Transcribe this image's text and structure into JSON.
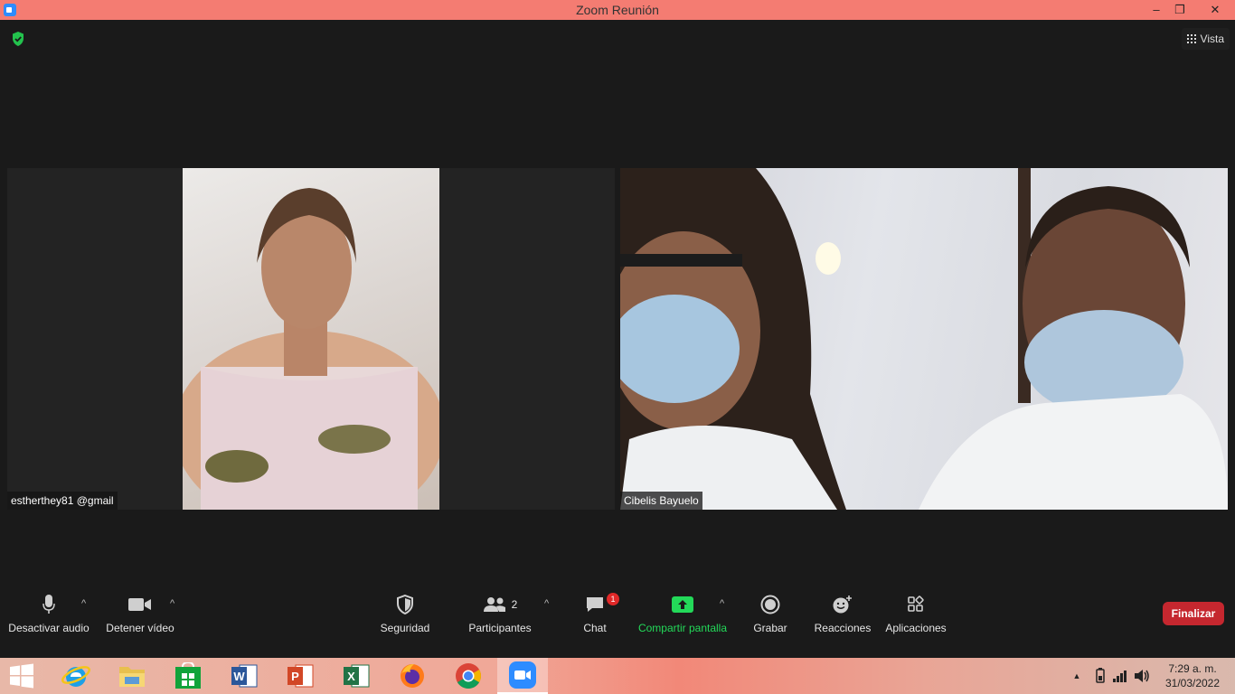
{
  "window": {
    "title": "Zoom Reunión",
    "minimize": "–",
    "maximize": "❐",
    "close": "✕"
  },
  "header": {
    "view_label": "Vista"
  },
  "participants": [
    {
      "name": "estherthey81 @gmail"
    },
    {
      "name": "Cibelis Bayuelo"
    }
  ],
  "toolbar": {
    "mute_label": "Desactivar audio",
    "video_label": "Detener vídeo",
    "security_label": "Seguridad",
    "participants_label": "Participantes",
    "participants_count": "2",
    "chat_label": "Chat",
    "chat_badge": "1",
    "share_label": "Compartir pantalla",
    "record_label": "Grabar",
    "reactions_label": "Reacciones",
    "apps_label": "Aplicaciones",
    "end_label": "Finalizar",
    "caret": "^"
  },
  "taskbar": {
    "apps": [
      "start-icon",
      "internet-explorer-icon",
      "file-explorer-icon",
      "store-icon",
      "word-icon",
      "powerpoint-icon",
      "excel-icon",
      "firefox-icon",
      "chrome-icon",
      "zoom-icon"
    ],
    "time": "7:29 a. m.",
    "date": "31/03/2022"
  },
  "colors": {
    "accent": "#2d8cff",
    "share": "#23d959",
    "end": "#c5272f",
    "badge": "#e02828",
    "titlebar": "#f47c72"
  }
}
